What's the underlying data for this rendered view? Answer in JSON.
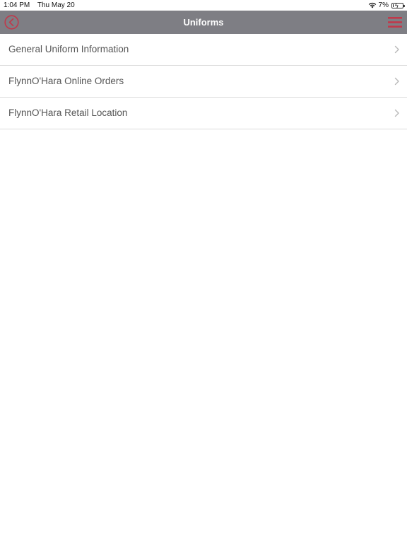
{
  "status_bar": {
    "time": "1:04 PM",
    "date": "Thu May 20",
    "battery_text": "7%",
    "battery_level": 0.07
  },
  "nav_bar": {
    "title": "Uniforms",
    "accent_color": "#c0394b",
    "background_color": "#7e7e84"
  },
  "list": {
    "items": [
      {
        "label": "General Uniform Information"
      },
      {
        "label": "FlynnO'Hara Online Orders"
      },
      {
        "label": "FlynnO'Hara Retail Location"
      }
    ]
  }
}
